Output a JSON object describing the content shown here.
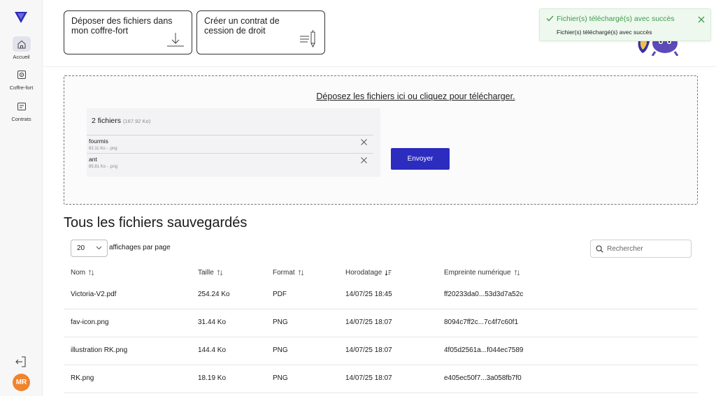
{
  "colors": {
    "brand": "#2c2cbf",
    "success": "#3e9b4a",
    "avatar": "#f0842c"
  },
  "sidebar": {
    "items": [
      {
        "label": "Accueil",
        "icon": "home-icon",
        "active": true
      },
      {
        "label": "Coffre-fort",
        "icon": "safe-icon",
        "active": false
      },
      {
        "label": "Contrats",
        "icon": "contract-icon",
        "active": false
      }
    ],
    "logout_icon": "logout-icon",
    "avatar_initials": "MR"
  },
  "actions": {
    "deposit_label": "Déposer des fichiers dans mon coffre-fort",
    "contract_label": "Créer un contrat de cession de droit"
  },
  "toast": {
    "title": "Fichier(s) téléchargé(s) avec succès",
    "message": "Fichier(s) téléchargé(s) avec succès"
  },
  "dropzone": {
    "prompt": "Déposez les fichiers ici ou cliquez pour télécharger.",
    "count_label": "2 fichiers",
    "total_size": "(167.92 Ko)",
    "files": [
      {
        "name": "fourmis",
        "meta": "82.11 Ko - .png"
      },
      {
        "name": "ant",
        "meta": "85.81 Ko - .png"
      }
    ],
    "send_label": "Envoyer"
  },
  "files_section": {
    "title": "Tous les fichiers sauvegardés",
    "page_size": "20",
    "per_page_label": "affichages par page",
    "search_placeholder": "Rechercher"
  },
  "table": {
    "columns": [
      "Nom",
      "Taille",
      "Format",
      "Horodatage",
      "Empreinte numérique"
    ],
    "rows": [
      {
        "name": "Victoria-V2.pdf",
        "size": "254.24 Ko",
        "format": "PDF",
        "timestamp": "14/07/25 18:45",
        "hash": "ff20233da0...53d3d7a52c"
      },
      {
        "name": "fav-icon.png",
        "size": "31.44 Ko",
        "format": "PNG",
        "timestamp": "14/07/25 18:07",
        "hash": "8094c7ff2c...7c4f7c60f1"
      },
      {
        "name": "illustration RK.png",
        "size": "144.4 Ko",
        "format": "PNG",
        "timestamp": "14/07/25 18:07",
        "hash": "4f05d2561a...f044ec7589"
      },
      {
        "name": "RK.png",
        "size": "18.19 Ko",
        "format": "PNG",
        "timestamp": "14/07/25 18:07",
        "hash": "e405ec50f7...3a058fb7f0"
      }
    ]
  }
}
